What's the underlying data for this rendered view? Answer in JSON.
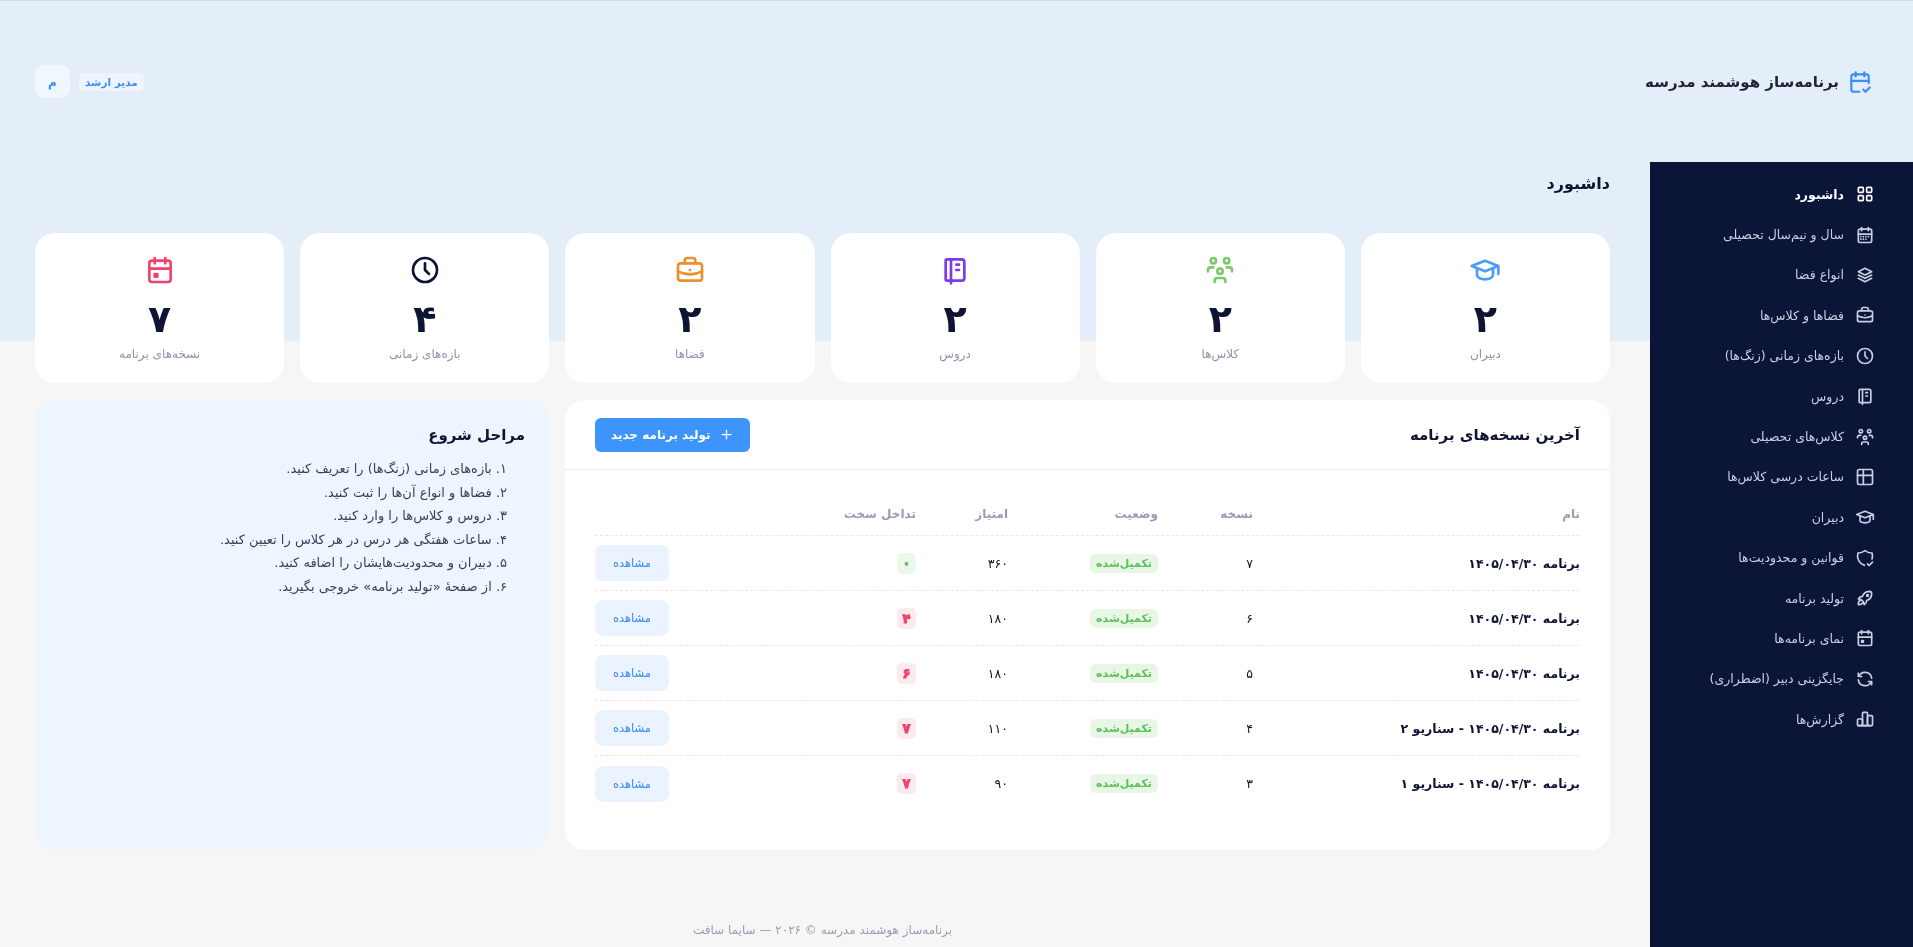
{
  "header": {
    "brand": "برنامه‌ساز هوشمند مدرسه",
    "user_role": "مدیر ارشد",
    "avatar_initial": "م"
  },
  "sidebar": {
    "items": [
      {
        "label": "داشبورد",
        "selected": true
      },
      {
        "label": "سال و نیم‌سال تحصیلی",
        "selected": false
      },
      {
        "label": "انواع فضا",
        "selected": false
      },
      {
        "label": "فضاها و کلاس‌ها",
        "selected": false
      },
      {
        "label": "بازه‌های زمانی (زنگ‌ها)",
        "selected": false
      },
      {
        "label": "دروس",
        "selected": false
      },
      {
        "label": "کلاس‌های تحصیلی",
        "selected": false
      },
      {
        "label": "ساعات درسی کلاس‌ها",
        "selected": false
      },
      {
        "label": "دبیران",
        "selected": false
      },
      {
        "label": "قوانین و محدودیت‌ها",
        "selected": false
      },
      {
        "label": "تولید برنامه",
        "selected": false
      },
      {
        "label": "نمای برنامه‌ها",
        "selected": false
      },
      {
        "label": "جایگزینی دبیر (اضطراری)",
        "selected": false
      },
      {
        "label": "گزارش‌ها",
        "selected": false
      }
    ]
  },
  "page_title": "داشبورد",
  "stats": [
    {
      "value": "۲",
      "label": "دبیران",
      "color": "#4a9cf5"
    },
    {
      "value": "۲",
      "label": "کلاس‌ها",
      "color": "#7ac96b"
    },
    {
      "value": "۲",
      "label": "دروس",
      "color": "#7c3aed"
    },
    {
      "value": "۲",
      "label": "فضاها",
      "color": "#e8912d"
    },
    {
      "value": "۴",
      "label": "بازه‌های زمانی",
      "color": "#0b1437"
    },
    {
      "value": "۷",
      "label": "نسخه‌های برنامه",
      "color": "#f0436a"
    }
  ],
  "programs": {
    "title": "آخرین نسخه‌های برنامه",
    "new_button": "تولید برنامه جدید",
    "columns": [
      "نام",
      "نسخه",
      "وضعیت",
      "امتیاز",
      "تداخل سخت"
    ],
    "rows": [
      {
        "name": "برنامه ۱۴۰۵/۰۴/۳۰",
        "version": "۷",
        "status": "تکمیل‌شده",
        "score": "۳۶۰",
        "conflicts": {
          "text": "۰",
          "color": "#5cbf5a"
        },
        "action": "مشاهده"
      },
      {
        "name": "برنامه ۱۴۰۵/۰۴/۳۰",
        "version": "۶",
        "status": "تکمیل‌شده",
        "score": "۱۸۰",
        "conflicts": {
          "text": "۴",
          "color": "#f0436a"
        },
        "action": "مشاهده"
      },
      {
        "name": "برنامه ۱۴۰۵/۰۴/۳۰",
        "version": "۵",
        "status": "تکمیل‌شده",
        "score": "۱۸۰",
        "conflicts": {
          "text": "۶",
          "color": "#f0436a"
        },
        "action": "مشاهده"
      },
      {
        "name": "برنامه ۱۴۰۵/۰۴/۳۰ - سناریو ۲",
        "version": "۴",
        "status": "تکمیل‌شده",
        "score": "۱۱۰",
        "conflicts": {
          "text": "۷",
          "color": "#f0436a"
        },
        "action": "مشاهده"
      },
      {
        "name": "برنامه ۱۴۰۵/۰۴/۳۰ - سناریو ۱",
        "version": "۳",
        "status": "تکمیل‌شده",
        "score": "۹۰",
        "conflicts": {
          "text": "۷",
          "color": "#f0436a"
        },
        "action": "مشاهده"
      }
    ]
  },
  "getting_started": {
    "title": "مراحل شروع",
    "steps": [
      "۱. بازه‌های زمانی (زنگ‌ها) را تعریف کنید.",
      "۲. فضاها و انواع آن‌ها را ثبت کنید.",
      "۳. دروس و کلاس‌ها را وارد کنید.",
      "۴. ساعات هفتگی هر درس در هر کلاس را تعیین کنید.",
      "۵. دبیران و محدودیت‌هایشان را اضافه کنید.",
      "۶. از صفحهٔ «تولید برنامه» خروجی بگیرید."
    ]
  },
  "footer": "برنامه‌ساز هوشمند مدرسه © ۲۰۲۶ — سایما سافت"
}
